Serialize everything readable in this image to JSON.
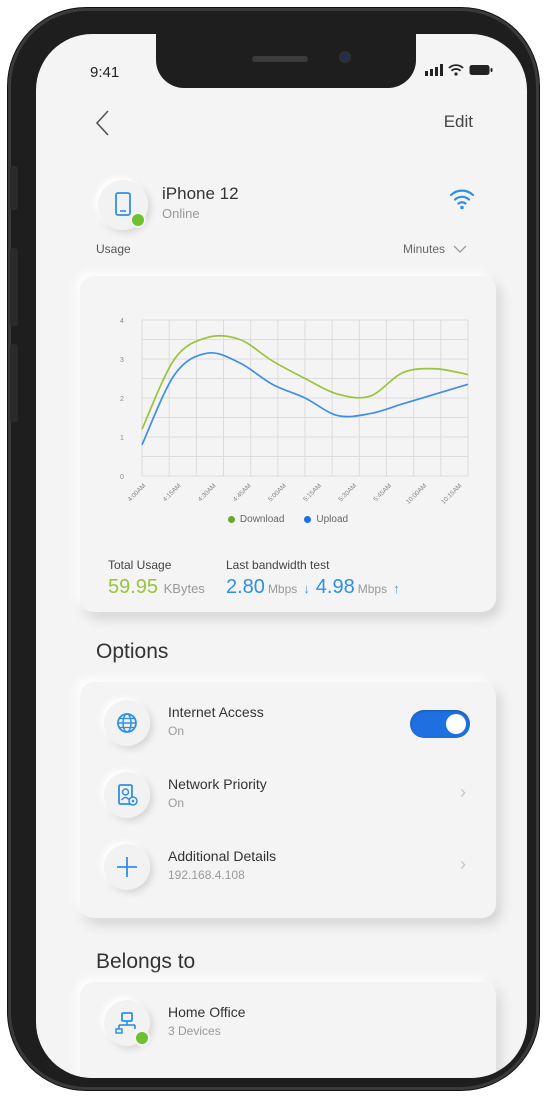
{
  "status_bar": {
    "time": "9:41"
  },
  "header": {
    "edit_label": "Edit"
  },
  "device": {
    "name": "iPhone 12",
    "status": "Online"
  },
  "usage": {
    "label": "Usage",
    "unit_selector": "Minutes"
  },
  "chart_data": {
    "type": "line",
    "title": "",
    "xlabel": "",
    "ylabel": "",
    "y_ticks": [
      "0",
      "1",
      "2",
      "3",
      "4"
    ],
    "ylim": [
      0,
      4
    ],
    "x": [
      "4:00AM",
      "4:15AM",
      "4:30AM",
      "4:45AM",
      "5:00AM",
      "5:15AM",
      "5:30AM",
      "5:45AM",
      "10:00AM",
      "10:15AM"
    ],
    "series": [
      {
        "name": "Download",
        "color": "#9ac43a",
        "values": [
          1.2,
          3.0,
          3.55,
          3.5,
          2.95,
          2.5,
          2.1,
          2.05,
          2.65,
          2.75,
          2.6
        ]
      },
      {
        "name": "Upload",
        "color": "#3d8fe8",
        "values": [
          0.8,
          2.6,
          3.15,
          2.9,
          2.35,
          2.0,
          1.55,
          1.6,
          1.85,
          2.1,
          2.35
        ]
      }
    ],
    "grid": true,
    "legend": "bottom-center"
  },
  "summary": {
    "total_label": "Total Usage",
    "total_value": "59.95",
    "total_unit": "KBytes",
    "bw_label": "Last bandwidth test",
    "download_value": "2.80",
    "download_unit": "Mbps",
    "upload_value": "4.98",
    "upload_unit": "Mbps"
  },
  "options": {
    "title": "Options",
    "items": [
      {
        "title": "Internet Access",
        "subtitle": "On",
        "icon": "globe-icon",
        "control": "toggle",
        "toggle_on": true
      },
      {
        "title": "Network Priority",
        "subtitle": "On",
        "icon": "network-priority-icon",
        "control": "chevron"
      },
      {
        "title": "Additional Details",
        "subtitle": "192.168.4.108",
        "icon": "plus-icon",
        "control": "chevron"
      }
    ]
  },
  "belongs": {
    "title": "Belongs to",
    "group_name": "Home Office",
    "group_count": "3 Devices"
  },
  "colors": {
    "accent_blue": "#2f8fe6",
    "accent_green": "#9ac43a",
    "online": "#6ec12e"
  }
}
